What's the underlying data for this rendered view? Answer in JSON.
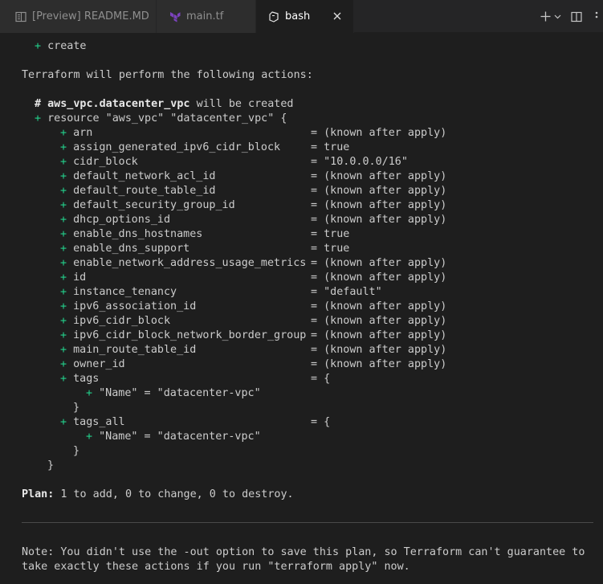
{
  "tabs": [
    {
      "label": "[Preview] README.MD",
      "icon": "preview-icon",
      "active": false
    },
    {
      "label": "main.tf",
      "icon": "terraform-icon",
      "active": false
    },
    {
      "label": "bash",
      "icon": "terminal-icon",
      "active": true
    }
  ],
  "tab_actions": {
    "new_terminal": "+",
    "dropdown": "⌄",
    "split": "split-icon"
  },
  "colors": {
    "plus": "#23d18b",
    "text": "#cccccc",
    "background": "#1e1e1e"
  },
  "terminal": {
    "top_plus": "+",
    "top_create": "create",
    "intro": "Terraform will perform the following actions:",
    "comment_hash": "#",
    "resource_addr": "aws_vpc.datacenter_vpc",
    "will_be_created": "will be created",
    "resource_plus": "+",
    "resource_decl": "resource \"aws_vpc\" \"datacenter_vpc\" {",
    "attributes": [
      {
        "name": "arn",
        "value": "= (known after apply)"
      },
      {
        "name": "assign_generated_ipv6_cidr_block",
        "value": "= true"
      },
      {
        "name": "cidr_block",
        "value": "= \"10.0.0.0/16\""
      },
      {
        "name": "default_network_acl_id",
        "value": "= (known after apply)"
      },
      {
        "name": "default_route_table_id",
        "value": "= (known after apply)"
      },
      {
        "name": "default_security_group_id",
        "value": "= (known after apply)"
      },
      {
        "name": "dhcp_options_id",
        "value": "= (known after apply)"
      },
      {
        "name": "enable_dns_hostnames",
        "value": "= true"
      },
      {
        "name": "enable_dns_support",
        "value": "= true"
      },
      {
        "name": "enable_network_address_usage_metrics",
        "value": "= (known after apply)"
      },
      {
        "name": "id",
        "value": "= (known after apply)"
      },
      {
        "name": "instance_tenancy",
        "value": "= \"default\""
      },
      {
        "name": "ipv6_association_id",
        "value": "= (known after apply)"
      },
      {
        "name": "ipv6_cidr_block",
        "value": "= (known after apply)"
      },
      {
        "name": "ipv6_cidr_block_network_border_group",
        "value": "= (known after apply)"
      },
      {
        "name": "main_route_table_id",
        "value": "= (known after apply)"
      },
      {
        "name": "owner_id",
        "value": "= (known after apply)"
      },
      {
        "name": "tags",
        "value": "= {"
      }
    ],
    "tags_entry": "\"Name\" = \"datacenter-vpc\"",
    "close_brace": "}",
    "tags_all_name": "tags_all",
    "tags_all_value": "= {",
    "tags_all_entry": "\"Name\" = \"datacenter-vpc\"",
    "plan_label": "Plan:",
    "plan_text": "1 to add, 0 to change, 0 to destroy.",
    "note_line1": "Note: You didn't use the -out option to save this plan, so Terraform can't guarantee to",
    "note_line2": "take exactly these actions if you run \"terraform apply\" now."
  }
}
